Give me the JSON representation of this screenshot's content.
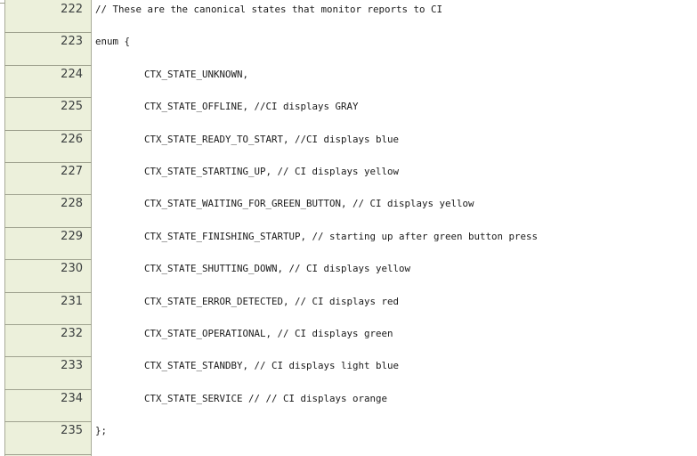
{
  "lines": [
    {
      "number": "222",
      "text": "// These are the canonical states that monitor reports to CI",
      "indent": 0
    },
    {
      "number": "223",
      "text": "enum {",
      "indent": 0
    },
    {
      "number": "224",
      "text": "CTX_STATE_UNKNOWN,",
      "indent": 1
    },
    {
      "number": "225",
      "text": "CTX_STATE_OFFLINE, //CI displays GRAY",
      "indent": 1
    },
    {
      "number": "226",
      "text": "CTX_STATE_READY_TO_START, //CI displays blue",
      "indent": 1
    },
    {
      "number": "227",
      "text": "CTX_STATE_STARTING_UP, // CI displays yellow",
      "indent": 1
    },
    {
      "number": "228",
      "text": "CTX_STATE_WAITING_FOR_GREEN_BUTTON, // CI displays yellow",
      "indent": 1
    },
    {
      "number": "229",
      "text": "CTX_STATE_FINISHING_STARTUP, // starting up after green button press",
      "indent": 1
    },
    {
      "number": "230",
      "text": "CTX_STATE_SHUTTING_DOWN, // CI displays yellow",
      "indent": 1
    },
    {
      "number": "231",
      "text": "CTX_STATE_ERROR_DETECTED, // CI displays red",
      "indent": 1
    },
    {
      "number": "232",
      "text": "CTX_STATE_OPERATIONAL, // CI displays green",
      "indent": 1
    },
    {
      "number": "233",
      "text": "CTX_STATE_STANDBY, // CI displays light blue",
      "indent": 1
    },
    {
      "number": "234",
      "text": "CTX_STATE_SERVICE // // CI displays orange",
      "indent": 1
    },
    {
      "number": "235",
      "text": "};",
      "indent": 0
    }
  ],
  "colors": {
    "gutter_background": "#ecf0db",
    "gutter_border": "#a8ab98",
    "line_number_text": "#3c4040",
    "code_text": "#1a1a1a",
    "page_background": "#ffffff"
  }
}
